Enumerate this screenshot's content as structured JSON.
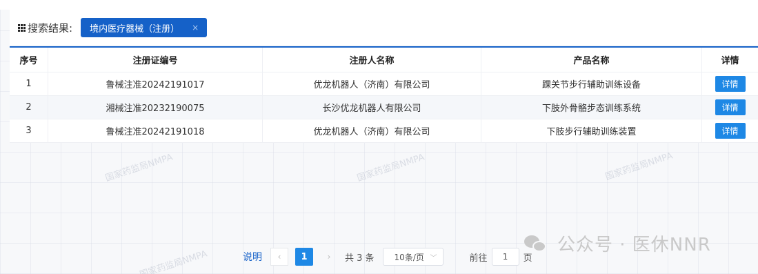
{
  "filter": {
    "label": "搜索结果:",
    "tag": "境内医疗器械（注册）",
    "tag_close": "×"
  },
  "table": {
    "headers": [
      "序号",
      "注册证编号",
      "注册人名称",
      "产品名称",
      "详情"
    ],
    "rows": [
      {
        "no": "1",
        "cert": "鲁械注准20242191017",
        "owner": "优龙机器人（济南）有限公司",
        "product": "踝关节步行辅助训练设备",
        "action": "详情"
      },
      {
        "no": "2",
        "cert": "湘械注准20232190075",
        "owner": "长沙优龙机器人有限公司",
        "product": "下肢外骨骼步态训练系统",
        "action": "详情"
      },
      {
        "no": "3",
        "cert": "鲁械注准20242191018",
        "owner": "优龙机器人（济南）有限公司",
        "product": "下肢步行辅助训练装置",
        "action": "详情"
      }
    ]
  },
  "pagination": {
    "help_link": "说明",
    "prev": "‹",
    "current_page": "1",
    "next": "›",
    "total": "共 3 条",
    "page_size": "10条/页",
    "goto_prefix": "前往",
    "goto_value": "1",
    "goto_suffix": "页"
  },
  "watermark_text": "国家药监局NMPA",
  "wechat_overlay": "公众号 · 医休NNR",
  "colors": {
    "accent": "#1561c8",
    "button": "#1e88e5"
  }
}
